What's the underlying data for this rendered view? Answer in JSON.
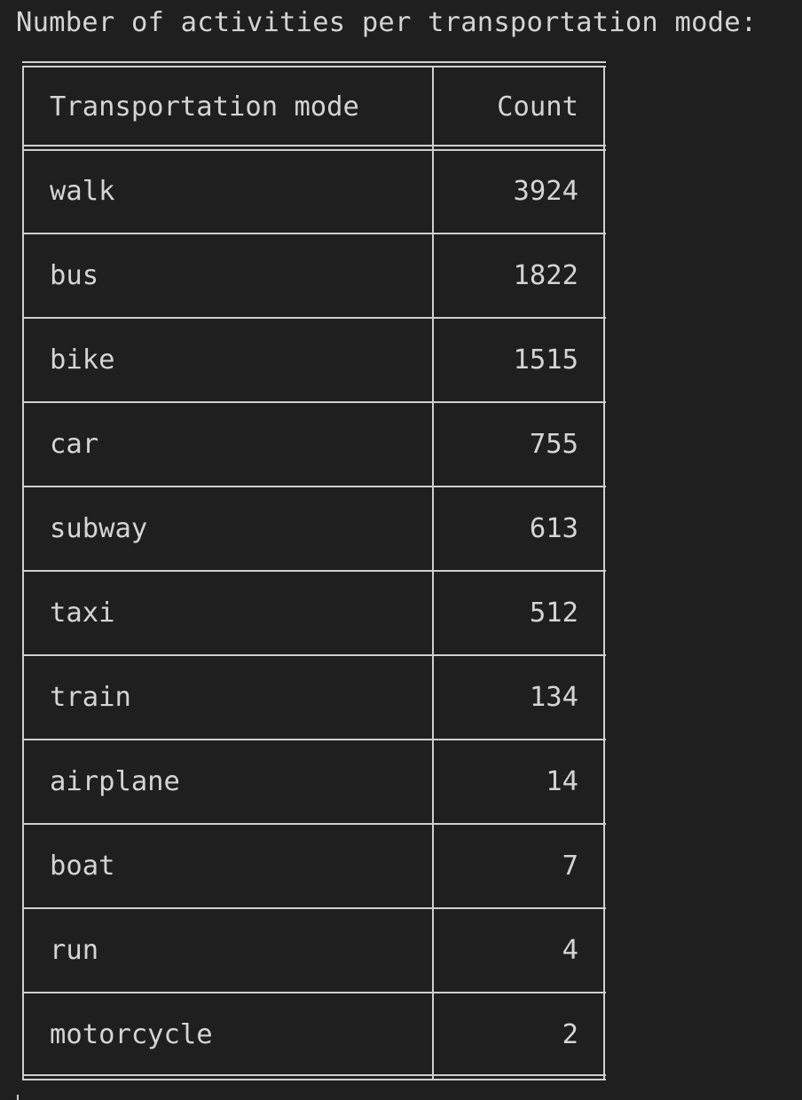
{
  "title": "Number of activities per transportation mode:",
  "table": {
    "headers": [
      "Transportation mode",
      "Count"
    ],
    "rows": [
      {
        "mode": "walk",
        "count": "3924"
      },
      {
        "mode": "bus",
        "count": "1822"
      },
      {
        "mode": "bike",
        "count": "1515"
      },
      {
        "mode": "car",
        "count": "755"
      },
      {
        "mode": "subway",
        "count": "613"
      },
      {
        "mode": "taxi",
        "count": "512"
      },
      {
        "mode": "train",
        "count": "134"
      },
      {
        "mode": "airplane",
        "count": "14"
      },
      {
        "mode": "boat",
        "count": "7"
      },
      {
        "mode": "run",
        "count": "4"
      },
      {
        "mode": "motorcycle",
        "count": "2"
      }
    ]
  }
}
